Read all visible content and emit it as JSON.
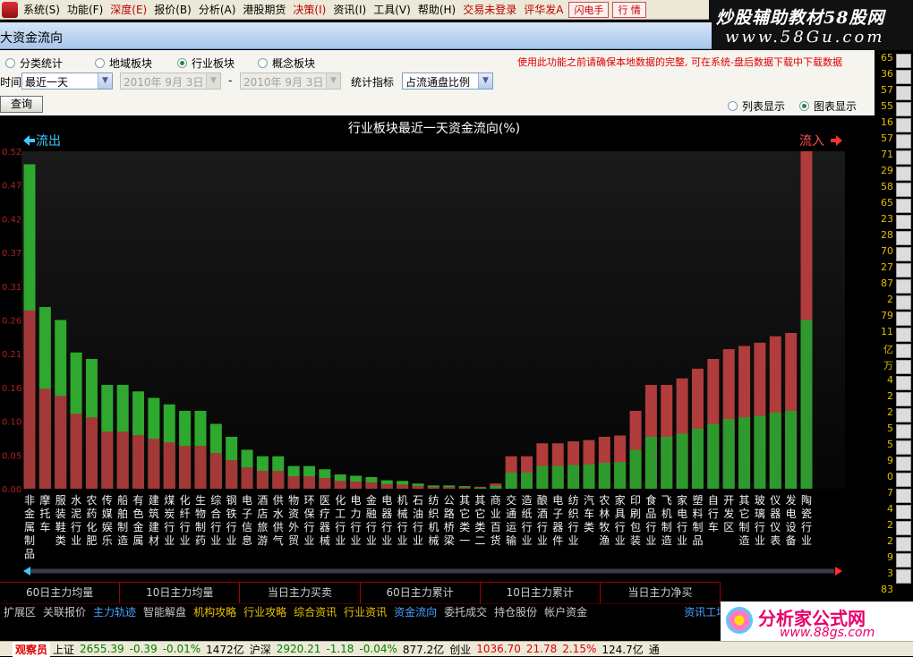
{
  "menubar": {
    "items": [
      "系统(S)",
      "功能(F)",
      "深度(E)",
      "报价(B)",
      "分析(A)",
      "港股期货",
      "决策(I)",
      "资讯(I)",
      "工具(V)",
      "帮助(H)"
    ],
    "login_status": "交易未登录",
    "broker": "评华发A",
    "flash_button": "闪电手",
    "quote_button": "行 情"
  },
  "watermark_top": {
    "line1": "炒股辅助教材58股网",
    "line2": "www.58Gu.com"
  },
  "window": {
    "title": "大资金流向"
  },
  "filters": {
    "categories": [
      {
        "label": "分类统计",
        "selected": false
      },
      {
        "label": "地域板块",
        "selected": false
      },
      {
        "label": "行业板块",
        "selected": true
      },
      {
        "label": "概念板块",
        "selected": false
      }
    ],
    "notice": "使用此功能之前请确保本地数据的完整, 可在系统-盘后数据下载中下载数据",
    "time_label": "时间",
    "time_value": "最近一天",
    "date_from": "2010年 9月 3日",
    "date_sep": "-",
    "date_to": "2010年 9月 3日",
    "indicator_label": "统计指标",
    "indicator_value": "占流通盘比例",
    "query_button": "查询",
    "display_modes": [
      {
        "label": "列表显示",
        "selected": false
      },
      {
        "label": "图表显示",
        "selected": true
      }
    ]
  },
  "chart_data": {
    "type": "bar",
    "title": "行业板块最近一天资金流向(%)",
    "left_label": "流出",
    "right_label": "流入",
    "ylim": [
      0,
      0.52
    ],
    "yticks": [
      "0.52",
      "0.47",
      "0.42",
      "0.37",
      "0.31",
      "0.26",
      "0.21",
      "0.16",
      "0.10",
      "0.05",
      "0.00"
    ],
    "colors": {
      "out_main": "#2ea82e",
      "out_base": "#a33838",
      "in_main": "#b03c3c",
      "in_base": "#2e9a2e"
    },
    "categories": [
      "非金属制品",
      "摩托车",
      "服装鞋类",
      "水泥行业",
      "农药化肥",
      "传媒娱乐",
      "船舶制造",
      "有色金属",
      "建筑建材",
      "煤炭行业",
      "化纤行业",
      "生物制药",
      "综合行业",
      "钢铁行业",
      "电子信息",
      "酒店旅游",
      "供水供气",
      "物资外贸",
      "环保行业",
      "医疗器械",
      "化工行业",
      "电力行业",
      "金融行业",
      "电器行业",
      "机械行业",
      "石油行业",
      "纺织机械",
      "公路桥梁",
      "其它类一",
      "其它类二",
      "商业百货",
      "交通运输",
      "造纸行业",
      "酿酒行业",
      "电子器件",
      "纺织行业",
      "汽车类",
      "农林牧渔",
      "家具行业",
      "印刷包装",
      "食品行业",
      "飞机制造",
      "家电行业",
      "塑料制品",
      "自行车",
      "开发区",
      "其它制造",
      "玻璃行业",
      "仪器仪表",
      "发电设备",
      "陶瓷行业"
    ],
    "series": [
      {
        "name": "流出",
        "values": [
          0.5,
          0.28,
          0.26,
          0.21,
          0.2,
          0.16,
          0.16,
          0.15,
          0.14,
          0.13,
          0.12,
          0.12,
          0.1,
          0.08,
          0.06,
          0.05,
          0.05,
          0.035,
          0.035,
          0.03,
          0.022,
          0.02,
          0.018,
          0.013,
          0.012,
          0.008,
          0.005,
          0.005,
          0.004,
          0,
          0,
          0,
          0,
          0,
          0,
          0,
          0,
          0,
          0,
          0,
          0,
          0,
          0,
          0,
          0,
          0,
          0,
          0,
          0,
          0,
          0
        ]
      },
      {
        "name": "流入",
        "values": [
          0,
          0,
          0,
          0,
          0,
          0,
          0,
          0,
          0,
          0,
          0,
          0,
          0,
          0,
          0,
          0,
          0,
          0,
          0,
          0,
          0,
          0,
          0,
          0,
          0,
          0,
          0,
          0,
          0,
          0.003,
          0.008,
          0.05,
          0.05,
          0.07,
          0.07,
          0.073,
          0.075,
          0.08,
          0.082,
          0.12,
          0.16,
          0.16,
          0.17,
          0.185,
          0.2,
          0.215,
          0.22,
          0.225,
          0.235,
          0.24,
          0.52
        ]
      }
    ]
  },
  "tabs_row1": [
    "60日主力均量",
    "10日主力均量",
    "当日主力买卖",
    "60日主力累计",
    "10日主力累计",
    "当日主力净买"
  ],
  "tabs_row2": [
    "扩展区",
    "关联报价",
    "主力轨迹",
    "智能解盘",
    "机构攻略",
    "行业攻略",
    "综合资讯",
    "行业资讯",
    "资金流向",
    "委托成交",
    "持仓股份",
    "帐户资金",
    "资讯工场"
  ],
  "statusbar": {
    "badge": "观察员",
    "sh_label": "上证",
    "sh_value": "2655.39",
    "sh_change": "-0.39",
    "sh_pct": "-0.01%",
    "sh_amount": "1472亿",
    "sz_label": "沪深",
    "sz_value": "2920.21",
    "sz_change": "-1.18",
    "sz_pct": "-0.04%",
    "sz_amount": "877.2亿",
    "cy_label": "创业",
    "cy_value": "1036.70",
    "cy_change": "21.78",
    "cy_pct": "2.15%",
    "cy_amount": "124.7亿",
    "tail": "通"
  },
  "watermark_bottom": {
    "line1": "分析家公式网",
    "line2": "www.88gs.com"
  },
  "right_numbers": [
    "65",
    "36",
    "57",
    "55",
    "16",
    "57",
    "71",
    "29",
    "58",
    "65",
    "23",
    "28",
    "70",
    "27",
    "87",
    "2",
    "79",
    "11",
    "亿",
    "万",
    "4",
    "2",
    "2",
    "5",
    "5",
    "9",
    "0",
    "7",
    "4",
    "2",
    "2",
    "9",
    "3",
    "83"
  ]
}
